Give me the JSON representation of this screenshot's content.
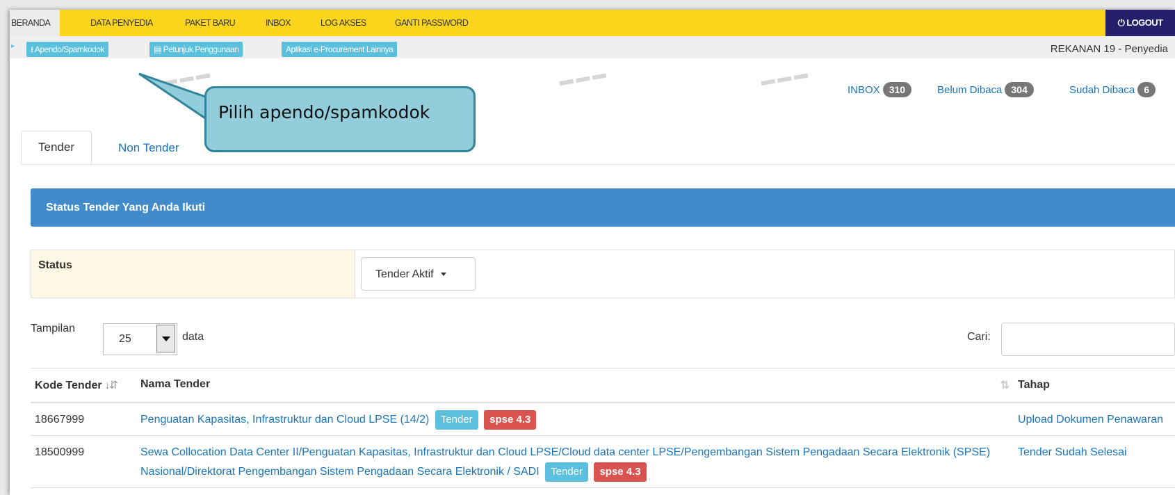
{
  "nav": {
    "items": [
      "BERANDA",
      "DATA PENYEDIA",
      "PAKET BARU",
      "INBOX",
      "LOG AKSES",
      "GANTI PASSWORD"
    ],
    "logout": "LOGOUT"
  },
  "subbar": {
    "apendo": "Apendo/Spamkodok",
    "petunjuk": "Petunjuk Penggunaan",
    "aplikasi": "Aplikasi e-Procurement Lainnya",
    "user": "REKANAN 19 - Penyedia"
  },
  "inbox": {
    "inbox_label": "INBOX",
    "inbox_count": "310",
    "belum_label": "Belum Dibaca",
    "belum_count": "304",
    "sudah_label": "Sudah Dibaca",
    "sudah_count": "6"
  },
  "callout": "Pilih apendo/spamkodok",
  "tabs": [
    "Tender",
    "Non Tender"
  ],
  "panel_title": "Status Tender Yang Anda Ikuti",
  "filter": {
    "label": "Status",
    "value": "Tender Aktif"
  },
  "length": {
    "prefix": "Tampilan",
    "value": "25",
    "suffix": "data"
  },
  "search_label": "Cari:",
  "table": {
    "headers": [
      "Kode Tender",
      "Nama Tender",
      "Tahap"
    ],
    "rows": [
      {
        "kode": "18667999",
        "nama": "Penguatan Kapasitas, Infrastruktur dan Cloud LPSE (14/2)",
        "tag1": "Tender",
        "tag2": "spse 4.3",
        "tahap": "Upload Dokumen Penawaran"
      },
      {
        "kode": "18500999",
        "nama": "Sewa Collocation Data Center II/Penguatan Kapasitas, Infrastruktur dan Cloud LPSE/Cloud data center LPSE/Pengembangan Sistem Pengadaan Secara Elektronik (SPSE) Nasional/Direktorat Pengembangan Sistem Pengadaan Secara Elektronik / SADI",
        "tag1": "Tender",
        "tag2": "spse 4.3",
        "tahap": "Tender Sudah Selesai"
      }
    ]
  },
  "colors": {
    "nav": "#fcd51c",
    "logout": "#251e6b",
    "panel": "#428bca",
    "link": "#1a75bb",
    "callout": "#92cddc"
  }
}
